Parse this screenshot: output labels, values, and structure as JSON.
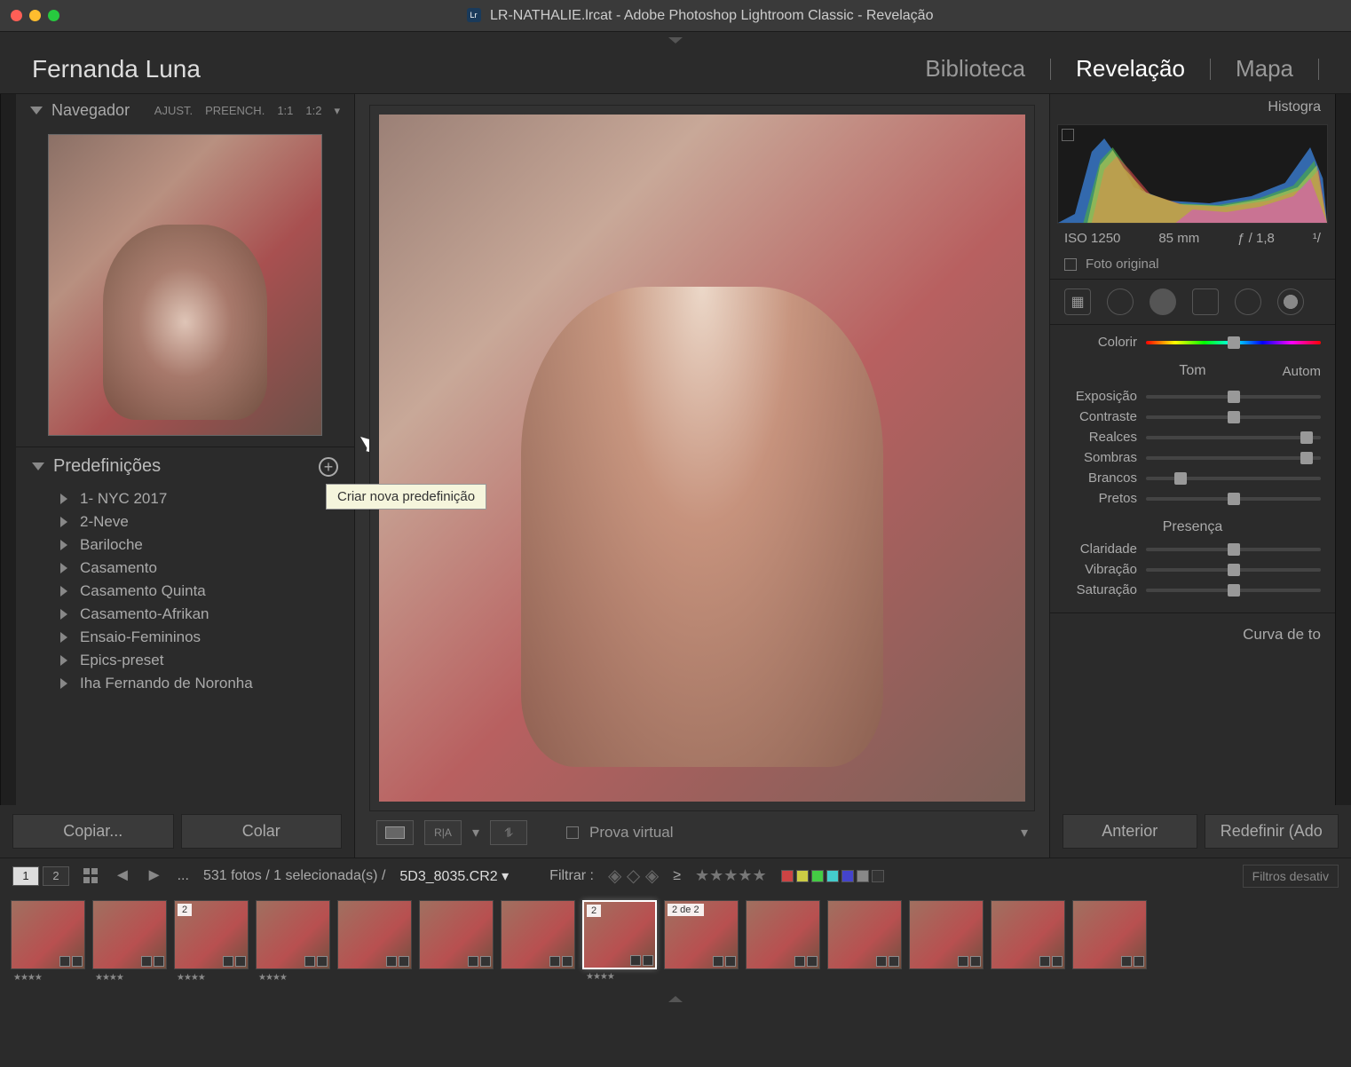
{
  "window": {
    "title": "LR-NATHALIE.lrcat - Adobe Photoshop Lightroom Classic - Revelação"
  },
  "identity": "Fernanda Luna",
  "modules": {
    "library": "Biblioteca",
    "develop": "Revelação",
    "map": "Mapa"
  },
  "navigator": {
    "title": "Navegador",
    "fit": "AJUST.",
    "fill": "PREENCH.",
    "one_to_one": "1:1",
    "custom": "1:2"
  },
  "presets": {
    "title": "Predefinições",
    "tooltip": "Criar nova predefinição",
    "items": [
      "1- NYC 2017",
      "2-Neve",
      "Bariloche",
      "Casamento",
      "Casamento Quinta",
      "Casamento-Afrikan",
      "Ensaio-Femininos",
      "Epics-preset",
      "Iha Fernando de Noronha"
    ]
  },
  "left_buttons": {
    "copy": "Copiar...",
    "paste": "Colar"
  },
  "toolbar": {
    "soft_proof": "Prova virtual"
  },
  "histogram": {
    "title": "Histogra",
    "iso": "ISO 1250",
    "focal": "85 mm",
    "aperture": "ƒ / 1,8",
    "shutter_prefix": "¹/"
  },
  "original": {
    "label": "Foto original"
  },
  "basic": {
    "tint_label": "Colorir",
    "tone_title": "Tom",
    "auto": "Autom",
    "exposure": "Exposição",
    "contrast": "Contraste",
    "highlights": "Realces",
    "shadows": "Sombras",
    "whites": "Brancos",
    "blacks": "Pretos",
    "presence_title": "Presença",
    "clarity": "Claridade",
    "vibrance": "Vibração",
    "saturation": "Saturação"
  },
  "curve": {
    "title": "Curva de to"
  },
  "right_buttons": {
    "previous": "Anterior",
    "reset": "Redefinir (Ado"
  },
  "filmstrip_info": {
    "view1": "1",
    "view2": "2",
    "path_prefix": "...",
    "count": "531 fotos / 1 selecionada(s) /",
    "filename": "5D3_8035.CR2",
    "filter_label": "Filtrar :",
    "ge_symbol": "≥",
    "filters_disabled": "Filtros desativ"
  },
  "thumbs": {
    "badge2": "2",
    "badge2de2": "2 de 2",
    "stars4": "★★★★"
  },
  "slider_positions": {
    "tint": 50,
    "exposure": 50,
    "contrast": 50,
    "highlights": 92,
    "shadows": 92,
    "whites": 20,
    "blacks": 50,
    "clarity": 50,
    "vibrance": 50,
    "saturation": 50
  },
  "color_labels": [
    "#c44",
    "#cc4",
    "#4c4",
    "#4cc",
    "#44c",
    "#888",
    "#333"
  ]
}
